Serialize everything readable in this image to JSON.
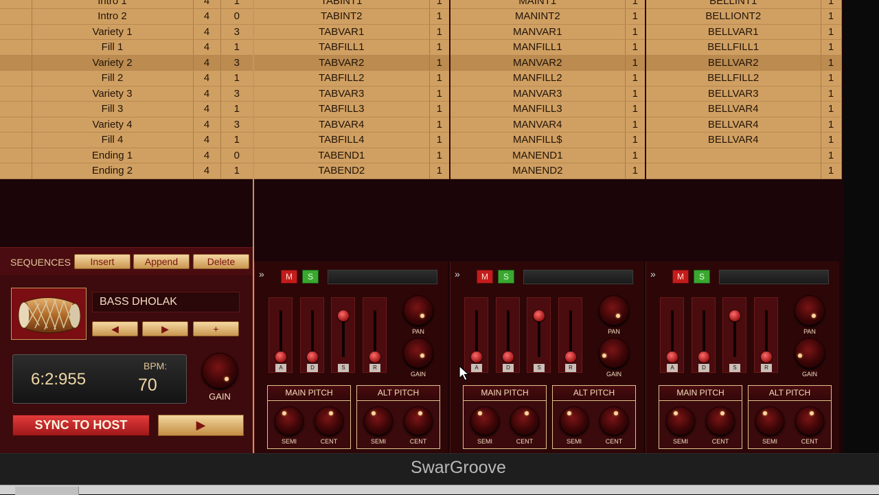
{
  "app": {
    "title": "SwarGroove"
  },
  "table": {
    "rows": [
      [
        "Intro 1",
        "4",
        "1",
        "TABINT1",
        "1",
        "MAINT1",
        "1",
        "BELLINT1",
        "1"
      ],
      [
        "Intro 2",
        "4",
        "0",
        "TABINT2",
        "1",
        "MANINT2",
        "1",
        "BELLIONT2",
        "1"
      ],
      [
        "Variety 1",
        "4",
        "3",
        "TABVAR1",
        "1",
        "MANVAR1",
        "1",
        "BELLVAR1",
        "1"
      ],
      [
        "Fill 1",
        "4",
        "1",
        "TABFILL1",
        "1",
        "MANFILL1",
        "1",
        "BELLFILL1",
        "1"
      ],
      [
        "Variety 2",
        "4",
        "3",
        "TABVAR2",
        "1",
        "MANVAR2",
        "1",
        "BELLVAR2",
        "1"
      ],
      [
        "Fill 2",
        "4",
        "1",
        "TABFILL2",
        "1",
        "MANFILL2",
        "1",
        "BELLFILL2",
        "1"
      ],
      [
        "Variety 3",
        "4",
        "3",
        "TABVAR3",
        "1",
        "MANVAR3",
        "1",
        "BELLVAR3",
        "1"
      ],
      [
        "Fill 3",
        "4",
        "1",
        "TABFILL3",
        "1",
        "MANFILL3",
        "1",
        "BELLVAR4",
        "1"
      ],
      [
        "Variety 4",
        "4",
        "3",
        "TABVAR4",
        "1",
        "MANVAR4",
        "1",
        "BELLVAR4",
        "1"
      ],
      [
        "Fill 4",
        "4",
        "1",
        "TABFILL4",
        "1",
        "MANFILL$",
        "1",
        "BELLVAR4",
        "1"
      ],
      [
        "Ending 1",
        "4",
        "0",
        "TABEND1",
        "1",
        "MANEND1",
        "1",
        "",
        "1"
      ],
      [
        "Ending 2",
        "4",
        "1",
        "TABEND2",
        "1",
        "MANEND2",
        "1",
        "",
        "1"
      ]
    ],
    "highlighted_row": 4
  },
  "sequences": {
    "label": "SEQUENCES",
    "insert": "Insert",
    "append": "Append",
    "delete": "Delete"
  },
  "instrument": {
    "name": "BASS DHOLAK",
    "prev": "◀",
    "next": "▶",
    "add": "+"
  },
  "transport": {
    "position": "6:2:955",
    "bpm_label": "BPM:",
    "bpm": "70",
    "gain_label": "GAIN",
    "sync": "SYNC TO HOST",
    "play": "▶"
  },
  "channel_strip": {
    "mute": "M",
    "solo": "S",
    "adsr": [
      "A",
      "D",
      "S",
      "R"
    ],
    "pan": "PAN",
    "gain": "GAIN",
    "main_pitch": "MAIN PITCH",
    "alt_pitch": "ALT PITCH",
    "semi": "SEMI",
    "cent": "CENT",
    "chevron": "»"
  },
  "colors": {
    "table_bg": "#d0a063",
    "dark_red": "#2d0708",
    "accent_red": "#c41c1c",
    "solo_green": "#3aa830",
    "gold": "#e4c38f"
  }
}
